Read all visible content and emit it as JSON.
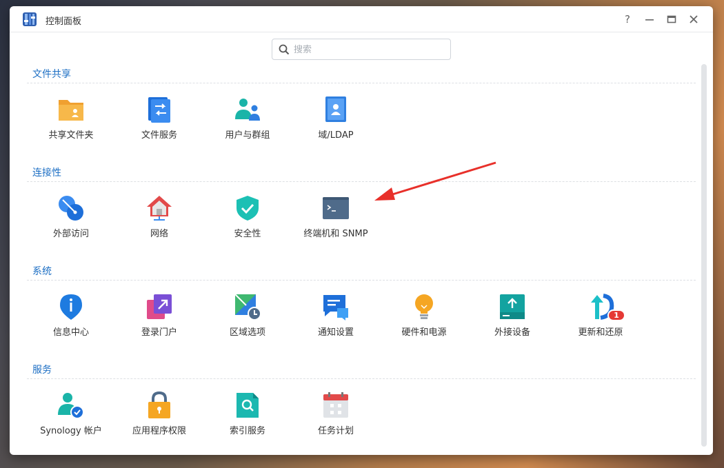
{
  "window": {
    "title": "控制面板"
  },
  "titlebar": {
    "help": "?",
    "minimize": "–",
    "maximize": "▭",
    "close": "✕"
  },
  "search": {
    "placeholder": "搜索"
  },
  "sections": [
    {
      "title": "文件共享",
      "items": [
        {
          "label": "共享文件夹",
          "icon": "shared-folder-icon"
        },
        {
          "label": "文件服务",
          "icon": "file-services-icon"
        },
        {
          "label": "用户与群组",
          "icon": "user-group-icon"
        },
        {
          "label": "域/LDAP",
          "icon": "domain-ldap-icon"
        }
      ]
    },
    {
      "title": "连接性",
      "items": [
        {
          "label": "外部访问",
          "icon": "external-access-icon"
        },
        {
          "label": "网络",
          "icon": "network-icon"
        },
        {
          "label": "安全性",
          "icon": "security-shield-icon"
        },
        {
          "label": "终端机和 SNMP",
          "icon": "terminal-icon"
        }
      ]
    },
    {
      "title": "系统",
      "items": [
        {
          "label": "信息中心",
          "icon": "info-center-icon"
        },
        {
          "label": "登录门户",
          "icon": "login-portal-icon"
        },
        {
          "label": "区域选项",
          "icon": "regional-options-icon"
        },
        {
          "label": "通知设置",
          "icon": "notification-icon"
        },
        {
          "label": "硬件和电源",
          "icon": "hardware-power-icon"
        },
        {
          "label": "外接设备",
          "icon": "external-devices-icon"
        },
        {
          "label": "更新和还原",
          "icon": "update-restore-icon",
          "badge": "1"
        }
      ]
    },
    {
      "title": "服务",
      "items": [
        {
          "label": "Synology 帐户",
          "icon": "synology-account-icon"
        },
        {
          "label": "应用程序权限",
          "icon": "app-privileges-icon"
        },
        {
          "label": "索引服务",
          "icon": "indexing-service-icon"
        },
        {
          "label": "任务计划",
          "icon": "task-scheduler-icon"
        }
      ]
    }
  ],
  "colors": {
    "accent": "#1d6fc4",
    "badge": "#e53935",
    "annotation_arrow": "#e8302a"
  }
}
